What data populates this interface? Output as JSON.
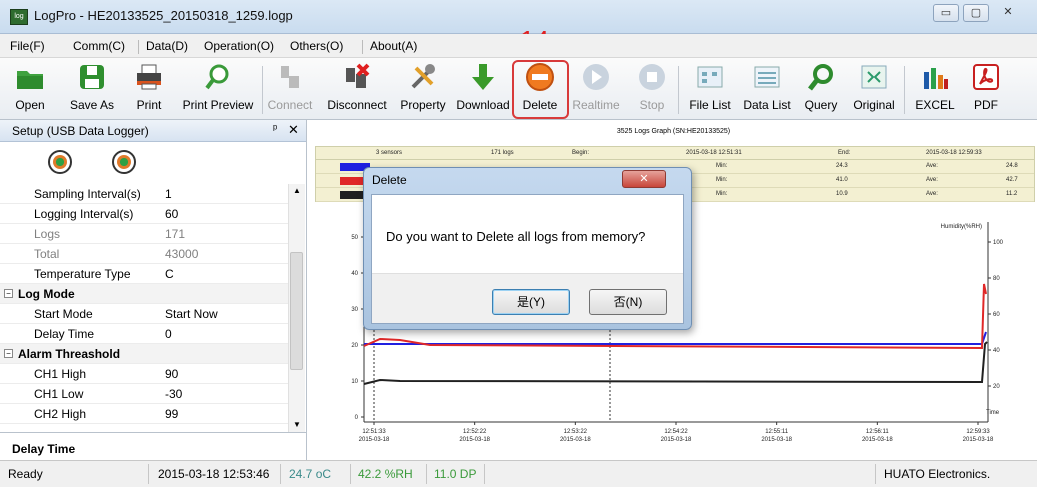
{
  "window": {
    "title": "LogPro - HE20133525_20150318_1259.logp",
    "icon": "log",
    "min": "▭",
    "max": "▢",
    "close": "✕"
  },
  "step_label": "14",
  "menu": [
    "File(F)",
    "Comm(C)",
    "Data(D)",
    "Operation(O)",
    "Others(O)",
    "About(A)"
  ],
  "toolbar": [
    {
      "label": "Open",
      "icon": "folder-icon",
      "enabled": true
    },
    {
      "label": "Save As",
      "icon": "save-icon",
      "enabled": true
    },
    {
      "label": "Print",
      "icon": "printer-icon",
      "enabled": true
    },
    {
      "label": "Print Preview",
      "icon": "magnifier-icon",
      "enabled": true
    },
    {
      "label": "Connect",
      "icon": "connect-icon",
      "enabled": false
    },
    {
      "label": "Disconnect",
      "icon": "disconnect-icon",
      "enabled": true
    },
    {
      "label": "Property",
      "icon": "tools-icon",
      "enabled": true
    },
    {
      "label": "Download",
      "icon": "download-arrow-icon",
      "enabled": true
    },
    {
      "label": "Delete",
      "icon": "delete-icon",
      "enabled": true
    },
    {
      "label": "Realtime",
      "icon": "play-icon",
      "enabled": false
    },
    {
      "label": "Stop",
      "icon": "stop-icon",
      "enabled": false
    },
    {
      "label": "File List",
      "icon": "file-list-icon",
      "enabled": true
    },
    {
      "label": "Data List",
      "icon": "data-list-icon",
      "enabled": true
    },
    {
      "label": "Query",
      "icon": "query-icon",
      "enabled": true
    },
    {
      "label": "Original",
      "icon": "original-icon",
      "enabled": true
    },
    {
      "label": "EXCEL",
      "icon": "excel-icon",
      "enabled": true
    },
    {
      "label": "PDF",
      "icon": "pdf-icon",
      "enabled": true
    }
  ],
  "panel": {
    "title": "Setup (USB Data Logger)",
    "pin": "ᵖ",
    "close": "✕",
    "rows": [
      {
        "type": "prop",
        "key": "Sampling Interval(s)",
        "value": "1",
        "dim": false
      },
      {
        "type": "prop",
        "key": "Logging Interval(s)",
        "value": "60",
        "dim": false
      },
      {
        "type": "prop",
        "key": "Logs",
        "value": "171",
        "dim": true
      },
      {
        "type": "prop",
        "key": "Total",
        "value": "43000",
        "dim": true
      },
      {
        "type": "prop",
        "key": "Temperature Type",
        "value": "C",
        "dim": false
      },
      {
        "type": "group",
        "key": "Log Mode"
      },
      {
        "type": "prop",
        "key": "Start Mode",
        "value": "Start Now",
        "dim": false
      },
      {
        "type": "prop",
        "key": "Delay Time",
        "value": "0",
        "dim": false
      },
      {
        "type": "group",
        "key": "Alarm Threashold"
      },
      {
        "type": "prop",
        "key": "CH1 High",
        "value": "90",
        "dim": false
      },
      {
        "type": "prop",
        "key": "CH1 Low",
        "value": "-30",
        "dim": false
      },
      {
        "type": "prop",
        "key": "CH2 High",
        "value": "99",
        "dim": false
      }
    ],
    "description_title": "Delay Time"
  },
  "graph": {
    "title": "3525 Logs Graph (SN:HE20133525)",
    "summary": {
      "sensors": "3 sensors",
      "logs": "171 logs",
      "begin_label": "Begin:",
      "begin": "2015-03-18 12:51:31",
      "end_label": "End:",
      "end": "2015-03-18 12:59:33"
    },
    "rows": [
      {
        "color": "#2020e0",
        "min": "24.3",
        "ave": "24.8"
      },
      {
        "color": "#e02828",
        "min": "41.0",
        "ave": "42.7"
      },
      {
        "color": "#202020",
        "min": "10.9",
        "ave": "11.2"
      }
    ],
    "min_label": "Min:",
    "ave_label": "Ave:",
    "right_axis_title": "Humidity(%RH)",
    "time_label": "Time",
    "left_ticks": [
      "0",
      "10",
      "20",
      "30",
      "40",
      "50"
    ],
    "right_ticks": [
      "20",
      "40",
      "60",
      "80",
      "100"
    ],
    "x_ticks": [
      {
        "t": "12:51:33",
        "d": "2015-03-18"
      },
      {
        "t": "12:52:22",
        "d": "2015-03-18"
      },
      {
        "t": "12:53:22",
        "d": "2015-03-18"
      },
      {
        "t": "12:54:22",
        "d": "2015-03-18"
      },
      {
        "t": "12:55:11",
        "d": "2015-03-18"
      },
      {
        "t": "12:56:11",
        "d": "2015-03-18"
      },
      {
        "t": "12:59:33",
        "d": "2015-03-18"
      }
    ]
  },
  "dialog": {
    "title": "Delete",
    "close": "✕",
    "message": "Do you want to Delete all logs from memory?",
    "yes": "是(Y)",
    "no": "否(N)"
  },
  "status": {
    "state": "Ready",
    "datetime": "2015-03-18 12:53:46",
    "temp": "24.7 oC",
    "humidity": "42.2 %RH",
    "dewpoint": "11.0 DP",
    "company": "HUATO Electronics."
  },
  "colors": {
    "accent_highlight": "#d83a3a",
    "temp_status": "#3a8a8a",
    "humidity_status": "#3a9a3a"
  }
}
